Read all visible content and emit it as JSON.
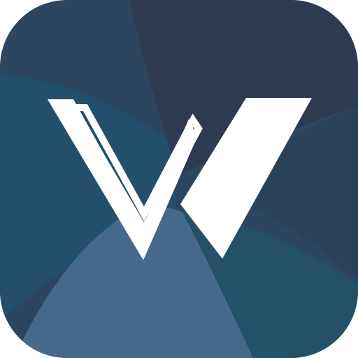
{
  "app_icon": {
    "icon": "w-logo-icon",
    "colors": {
      "background_dark": "#2d3a50",
      "background_mid": "#2c4660",
      "background_teal": "#234f6a",
      "background_light": "#46698a",
      "logo": "#ffffff"
    }
  }
}
